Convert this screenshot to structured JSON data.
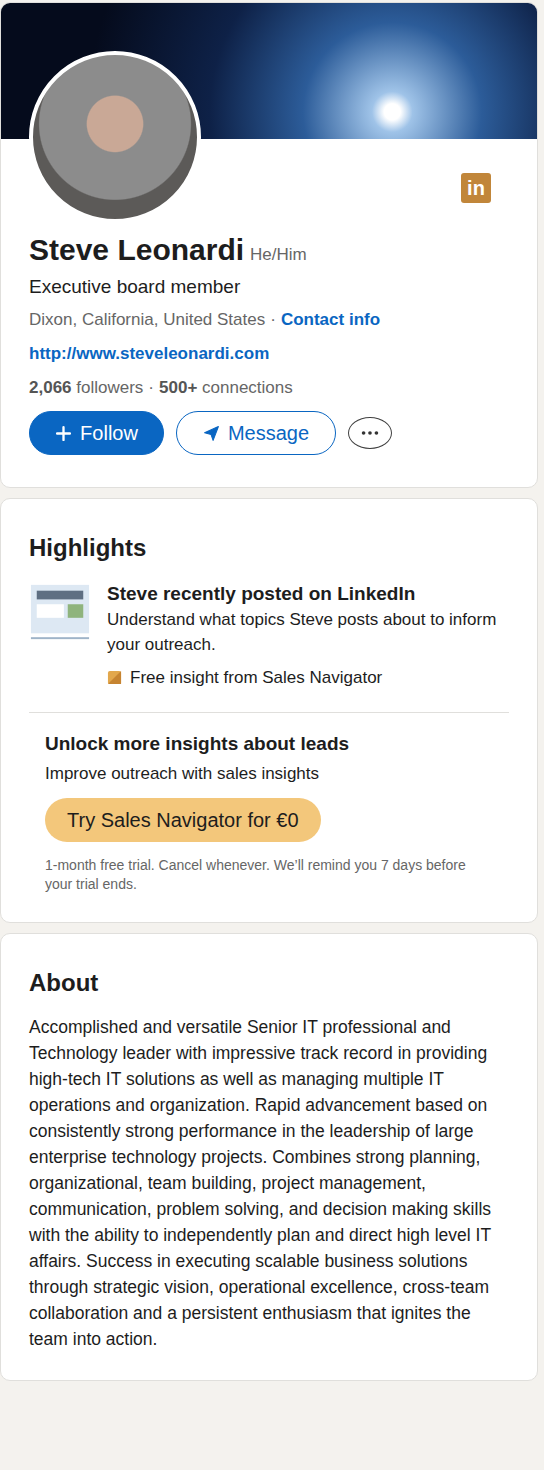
{
  "profile": {
    "name": "Steve Leonardi",
    "pronouns": "He/Him",
    "headline": "Executive board member",
    "location": "Dixon, California, United States",
    "location_separator": "·",
    "contact_info": "Contact info",
    "website": "http://www.steveleonardi.com",
    "followers": {
      "count": "2,066",
      "label": "followers"
    },
    "stats_separator": "·",
    "connections": {
      "count": "500+",
      "label": "connections"
    },
    "logo": "in"
  },
  "actions": [
    {
      "label": "Follow",
      "kind": "primary"
    },
    {
      "label": "Message",
      "kind": "secondary"
    }
  ],
  "highlights": {
    "title": "Highlights",
    "item": {
      "title": "Steve recently posted on LinkedIn",
      "description": "Understand what topics Steve posts about to inform your outreach.",
      "insight": "Free insight from Sales Navigator"
    },
    "upsell": {
      "title": "Unlock more insights about leads",
      "subtitle": "Improve outreach with sales insights",
      "button": "Try Sales Navigator for €0",
      "note": "1-month free trial. Cancel whenever. We’ll remind you 7 days before your trial ends."
    }
  },
  "about": {
    "title": "About",
    "text": "Accomplished and versatile Senior IT professional and Technology leader with impressive track record in providing high-tech IT solutions as well as managing multiple IT operations and organization. Rapid advancement based on consistently strong performance in the leadership of large enterprise technology projects. Combines strong planning, organizational, team building, project management, communication, problem solving, and decision making skills with the ability to independently plan and direct high level IT affairs. Success in executing scalable business solutions through strategic vision, operational excellence, cross-team collaboration and a persistent enthusiasm that ignites the team into action."
  }
}
